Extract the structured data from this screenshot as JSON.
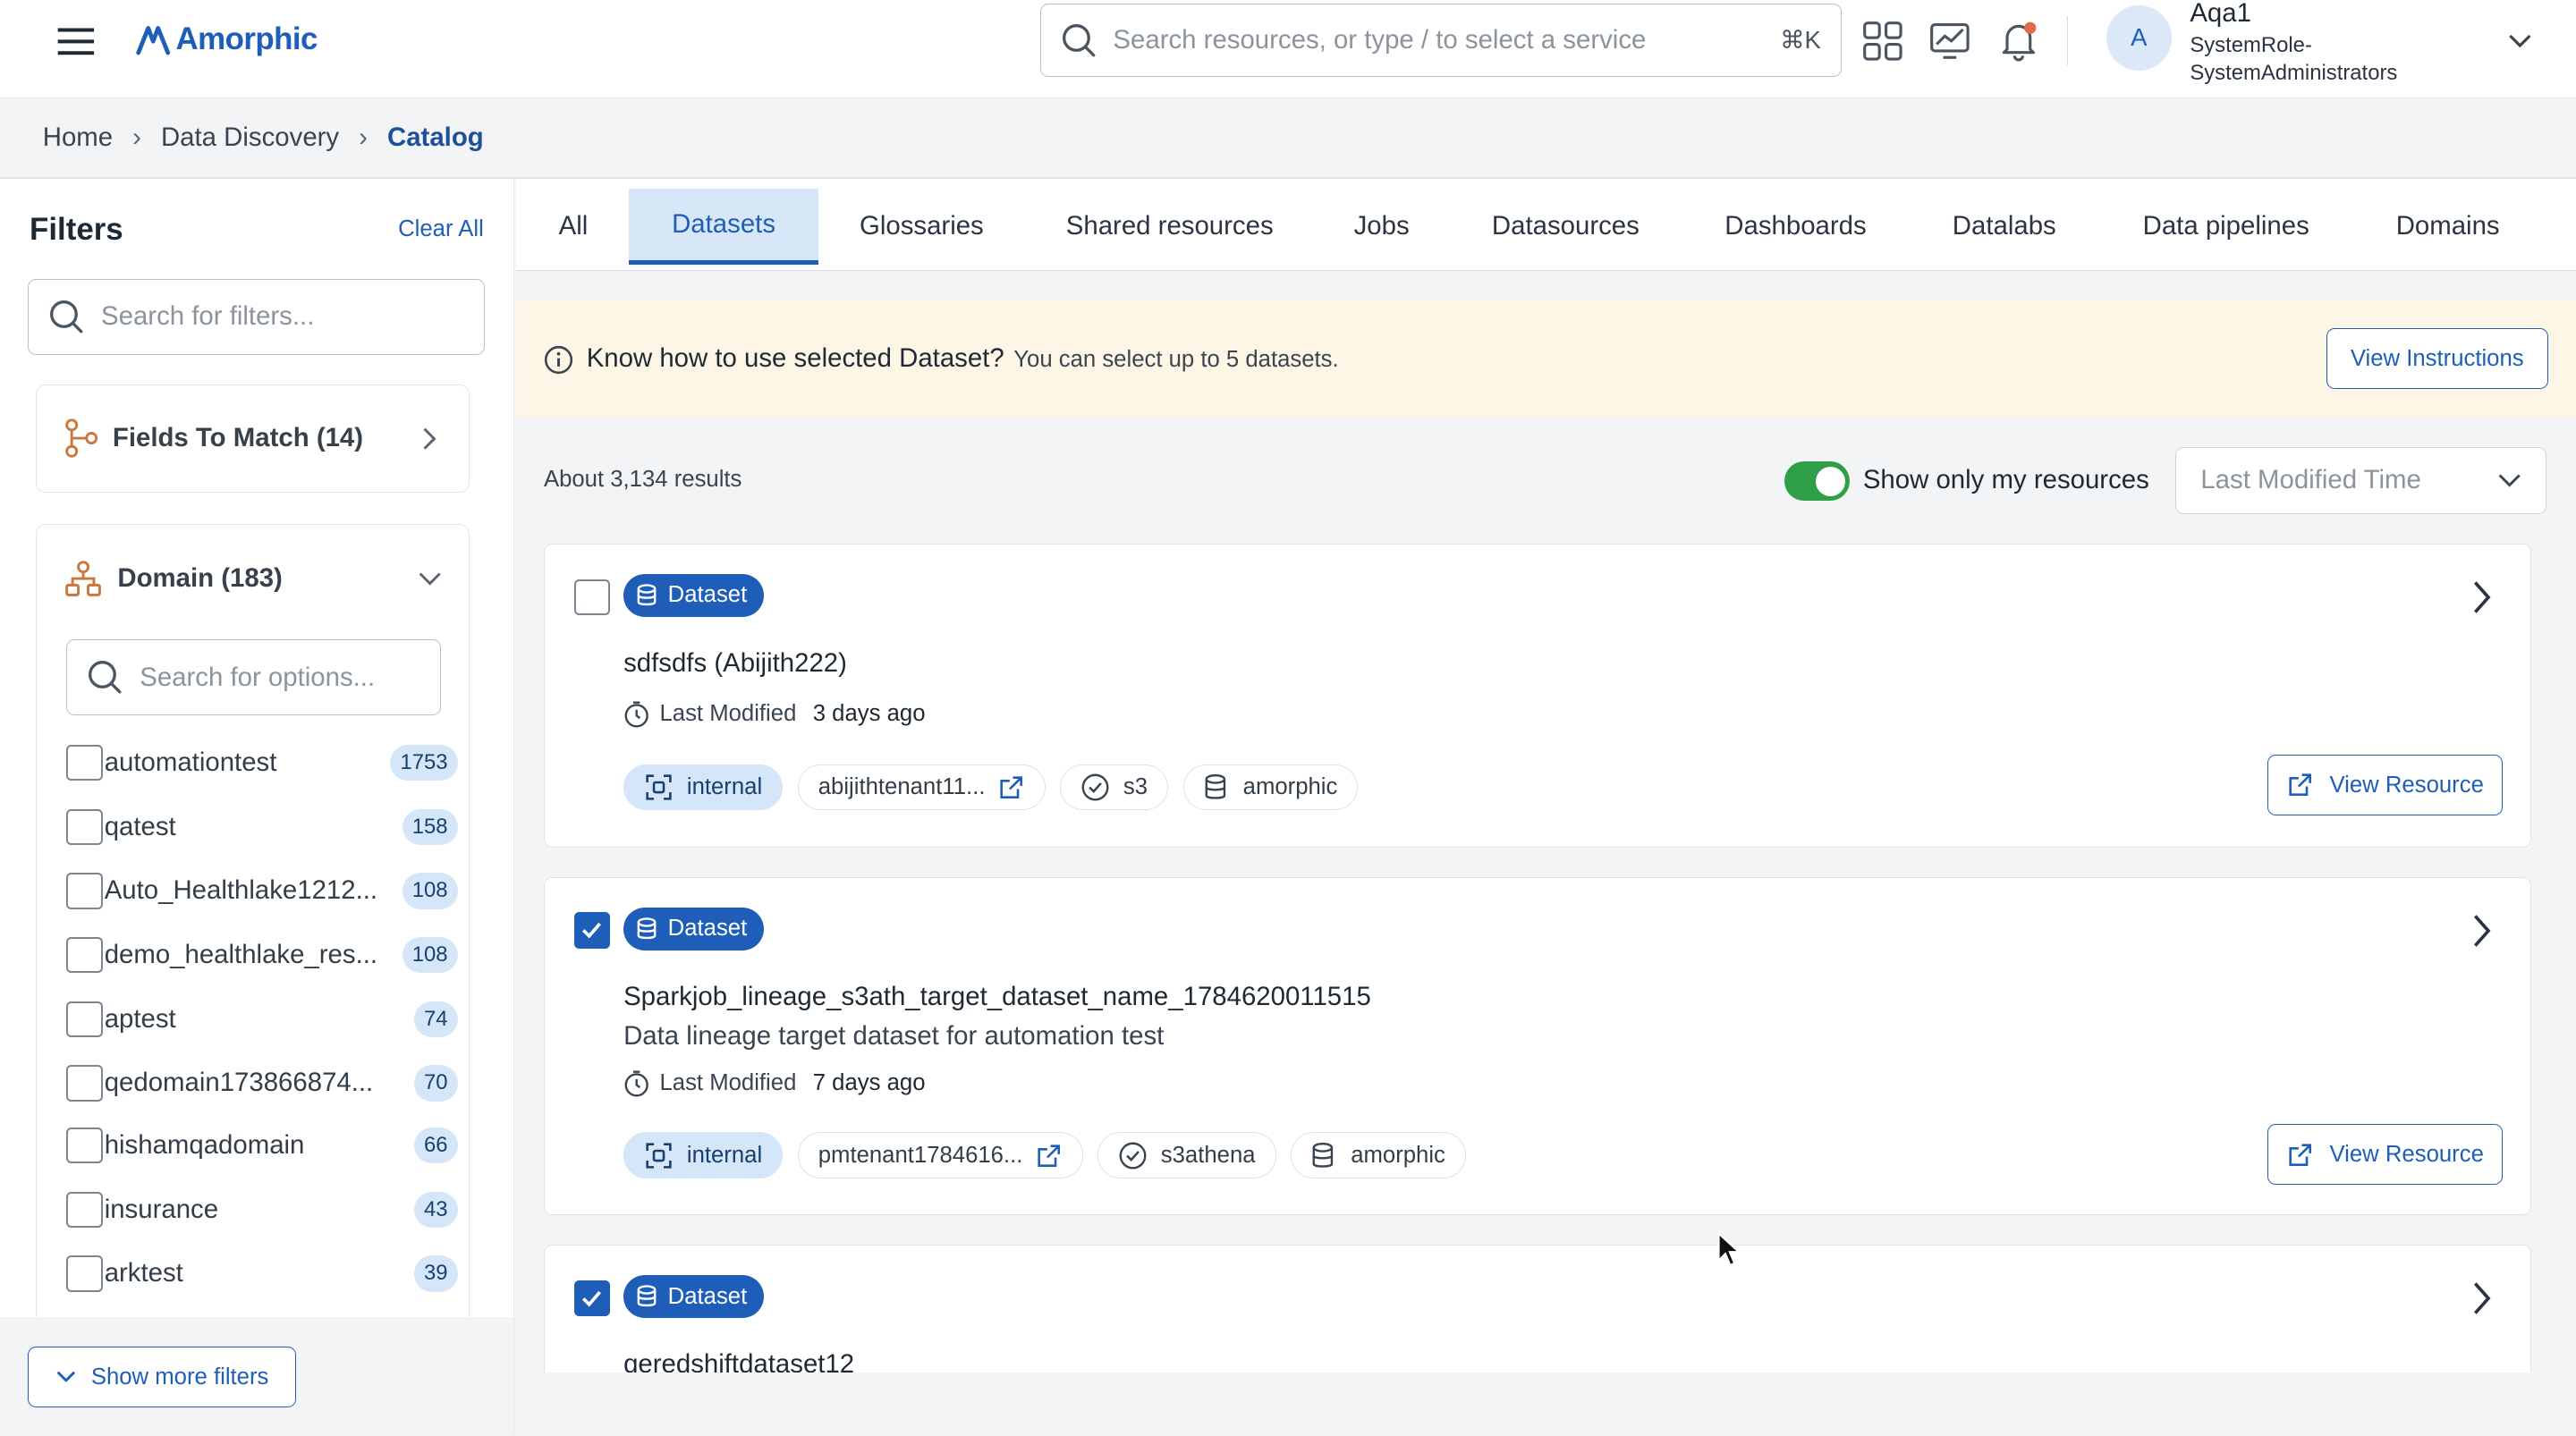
{
  "header": {
    "brand": "Amorphic",
    "search_placeholder": "Search resources, or type / to select a service",
    "search_shortcut": "⌘K",
    "user": {
      "initial": "A",
      "name": "Aqa1",
      "role": "SystemRole-SystemAdministrators"
    }
  },
  "breadcrumb": [
    "Home",
    "Data Discovery",
    "Catalog"
  ],
  "sidebar": {
    "title": "Filters",
    "clear_all": "Clear All",
    "search_placeholder": "Search for filters...",
    "fields_to_match": "Fields To Match (14)",
    "domain": {
      "title": "Domain (183)",
      "search_placeholder": "Search for options...",
      "options": [
        {
          "name": "automationtest",
          "count": "1753"
        },
        {
          "name": "qatest",
          "count": "158"
        },
        {
          "name": "Auto_Healthlake1212...",
          "count": "108"
        },
        {
          "name": "demo_healthlake_res...",
          "count": "108"
        },
        {
          "name": "aptest",
          "count": "74"
        },
        {
          "name": "qedomain173866874...",
          "count": "70"
        },
        {
          "name": "hishamqadomain",
          "count": "66"
        },
        {
          "name": "insurance",
          "count": "43"
        },
        {
          "name": "arktest",
          "count": "39"
        }
      ]
    },
    "show_more": "Show more filters"
  },
  "tabs": [
    "All",
    "Datasets",
    "Glossaries",
    "Shared resources",
    "Jobs",
    "Datasources",
    "Dashboards",
    "Datalabs",
    "Data pipelines",
    "Domains"
  ],
  "active_tab": "Datasets",
  "banner": {
    "message": "Know how to use selected Dataset?",
    "sub": "You can select up to 5 datasets.",
    "button": "View Instructions"
  },
  "results": {
    "count_text": "About 3,134 results",
    "toggle_label": "Show only my resources",
    "toggle_on": true,
    "sort_placeholder": "Last Modified Time"
  },
  "cards": [
    {
      "checked": false,
      "badge": "Dataset",
      "title": "sdfsdfs (Abijith222)",
      "description": "",
      "modified_label": "Last Modified",
      "modified_value": "3 days ago",
      "chips": {
        "visibility": "internal",
        "owner": "abijithtenant11...",
        "storage": "s3",
        "domain": "amorphic"
      },
      "action": "View Resource"
    },
    {
      "checked": true,
      "badge": "Dataset",
      "title": "Sparkjob_lineage_s3ath_target_dataset_name_1784620011515",
      "description": "Data lineage target dataset for automation test",
      "modified_label": "Last Modified",
      "modified_value": "7 days ago",
      "chips": {
        "visibility": "internal",
        "owner": "pmtenant1784616...",
        "storage": "s3athena",
        "domain": "amorphic"
      },
      "action": "View Resource"
    },
    {
      "checked": true,
      "badge": "Dataset",
      "title": "qeredshiftdataset12"
    }
  ],
  "colors": {
    "accent": "#1e5eb8",
    "toggle_on": "#2e9f47",
    "banner_bg": "#fdf5e6",
    "count_bg": "#d5e6f8"
  }
}
